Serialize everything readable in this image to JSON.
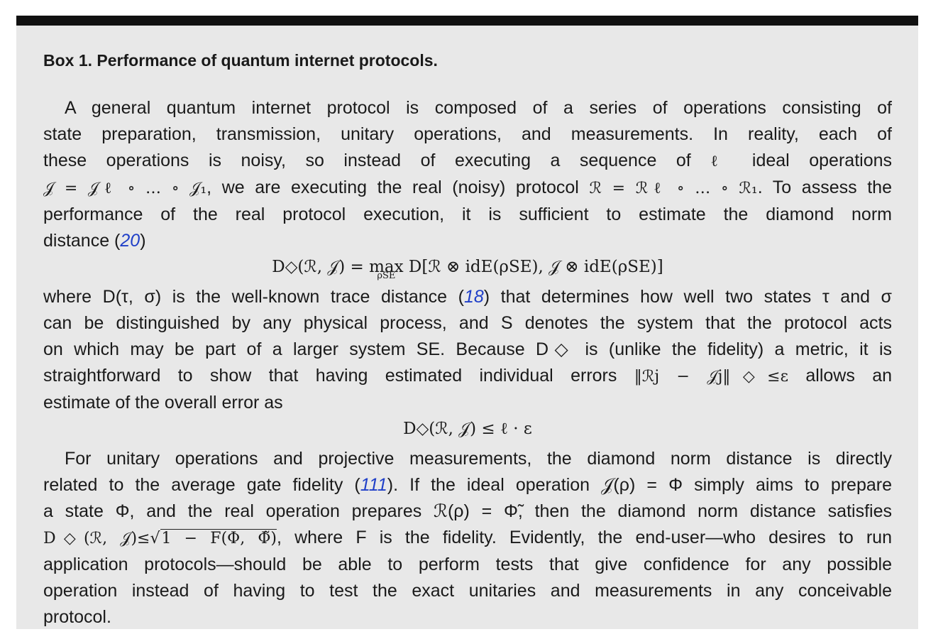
{
  "box": {
    "title": "Box 1. Performance of quantum internet protocols.",
    "p1": {
      "l1": "A general quantum internet protocol is composed of a series of operations consisting of",
      "l2": "state preparation, transmission, unitary operations, and measurements. In reality, each of",
      "l3a": "these operations is noisy, so instead of executing a sequence of",
      "l3m": "ℓ",
      "l3b": "ideal operations",
      "l4m1": "𝒥 = 𝒥ℓ ∘ … ∘ 𝒥₁",
      "l4a": ", we are executing the real (noisy) protocol",
      "l4m2": "ℛ = ℛℓ ∘ … ∘ ℛ₁",
      "l4b": ". To assess the",
      "l5": "performance of the real protocol execution, it is sufficient to estimate the diamond norm",
      "l6a": "distance (",
      "ref1": "20",
      "l6b": ")"
    },
    "eq1": {
      "lhs": "D◇(ℛ, 𝒥) = ",
      "max": "max",
      "max_sub": "ρSE",
      "rhs": " D[ℛ ⊗ idE(ρSE), 𝒥 ⊗ idE(ρSE)]"
    },
    "p2": {
      "l1a": "where D(τ, σ) is the well-known trace distance (",
      "ref2": "18",
      "l1b": ") that determines how well two states τ and σ",
      "l2": "can be distinguished by any physical process, and S denotes the system that the protocol acts",
      "l3": "on which may be part of a larger system SE. Because D◇ is (unlike the fidelity) a metric, it is",
      "l4a": "straightforward to show that having estimated individual errors",
      "l4m": "‖ℛj − 𝒥j‖◇≤ε",
      "l4b": "allows an",
      "l5": "estimate of the overall error as"
    },
    "eq2": "D◇(ℛ, 𝒥) ≤ ℓ · ε",
    "p3": {
      "l1": "For unitary operations and projective measurements, the diamond norm distance is directly",
      "l2a": "related to the average gate fidelity (",
      "ref3": "111",
      "l2b": "). If the ideal operation 𝒥(ρ) = Φ simply aims to prepare",
      "l3": "a state Φ, and the real operation prepares ℛ(ρ) = Φ̃, then the diamond norm distance satisfies",
      "l4m": "D◇(ℛ, 𝒥)≤",
      "l4sqrt": "1 − F(Φ, Φ̃)",
      "l4b": ", where F is the fidelity. Evidently, the end-user—who desires to run",
      "l5": "application protocols—should be able to perform tests that give confidence for any possible",
      "l6": "operation instead of having to test the exact unitaries and measurements in any conceivable",
      "l7": "protocol."
    }
  }
}
